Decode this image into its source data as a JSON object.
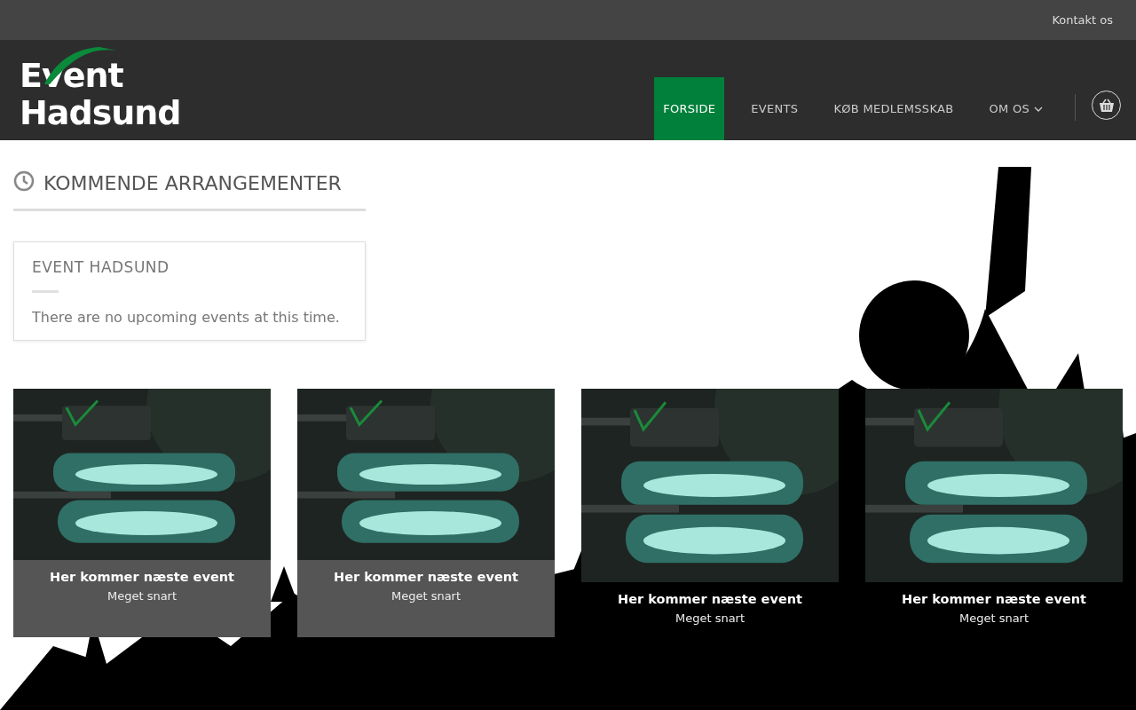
{
  "top_bar": {
    "link": "Kontakt os"
  },
  "logo": {
    "line1": "Event",
    "line2": "Hadsund"
  },
  "nav": [
    {
      "label": "FORSIDE",
      "selected": true,
      "dropdown": false
    },
    {
      "label": "EVENTS",
      "selected": false,
      "dropdown": false
    },
    {
      "label": "KØB MEDLEMSSKAB",
      "selected": false,
      "dropdown": false
    },
    {
      "label": "OM OS",
      "selected": false,
      "dropdown": true
    }
  ],
  "section": {
    "title": "KOMMENDE ARRANGEMENTER"
  },
  "widget": {
    "title": "EVENT HADSUND",
    "message": "There are no upcoming events at this time."
  },
  "cards": [
    {
      "kind": "boxed",
      "title": "Her kommer næste event",
      "subtitle": "Meget snart"
    },
    {
      "kind": "boxed",
      "title": "Her kommer næste event",
      "subtitle": "Meget snart"
    },
    {
      "kind": "plain",
      "title": "Her kommer næste event",
      "subtitle": "Meget snart"
    },
    {
      "kind": "plain",
      "title": "Her kommer næste event",
      "subtitle": "Meget snart"
    }
  ]
}
